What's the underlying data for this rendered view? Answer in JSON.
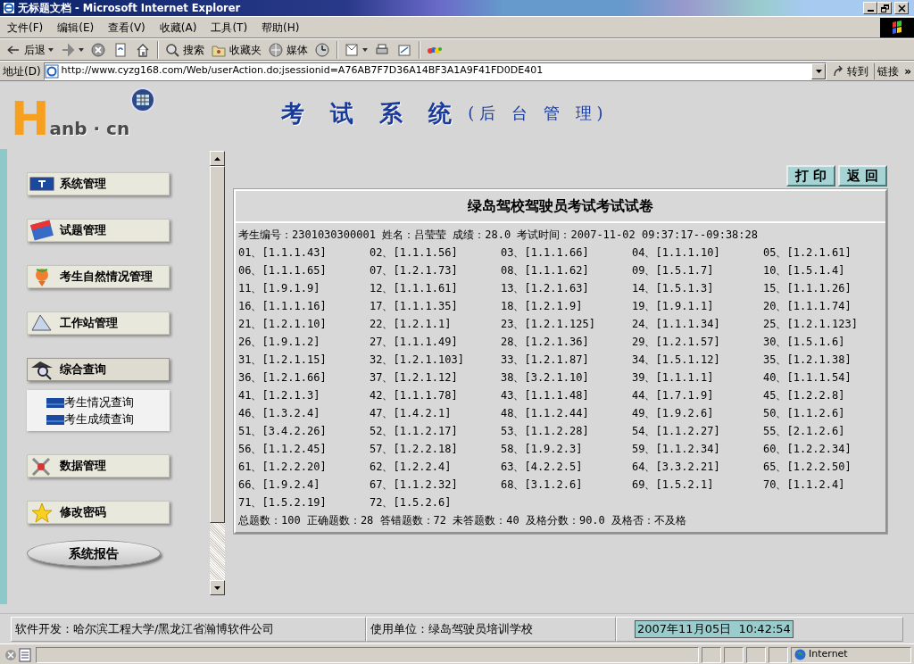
{
  "window": {
    "title": "无标题文档 - Microsoft Internet Explorer"
  },
  "menu": [
    "文件(F)",
    "编辑(E)",
    "查看(V)",
    "收藏(A)",
    "工具(T)",
    "帮助(H)"
  ],
  "toolbar": [
    [
      {
        "label": "后退",
        "dropdown": true
      },
      {
        "dropdown": true
      },
      {
        "dropdown": false
      },
      {
        "dropdown": false
      },
      {
        "dropdown": false
      }
    ],
    [
      {
        "label": "搜索",
        "dropdown": false
      },
      {
        "label": "收藏夹",
        "dropdown": false
      },
      {
        "label": "媒体",
        "dropdown": false
      },
      {
        "dropdown": false
      }
    ],
    [
      {
        "dropdown": true
      },
      {
        "dropdown": false
      },
      {
        "dropdown": false
      }
    ],
    [
      {
        "dropdown": false
      }
    ]
  ],
  "address": {
    "label": "地址(D)",
    "url": "http://www.cyzg168.com/Web/userAction.do;jsessionid=A76AB7F7D36A14BF3A1A9F41FD0DE401",
    "go": "转到",
    "links": "链接",
    "more": "»"
  },
  "header": {
    "logo_letter": "H",
    "logo_rest": "anb · cn",
    "title": "考 试 系 统",
    "subtitle": "(后 台 管 理)"
  },
  "sidebar": {
    "items": [
      {
        "label": "系统管理"
      },
      {
        "label": "试题管理"
      },
      {
        "label": "考生自然情况管理"
      },
      {
        "label": "工作站管理"
      },
      {
        "label": "综合查询",
        "expanded": true,
        "children": [
          {
            "label": "考生情况查询"
          },
          {
            "label": "考生成绩查询"
          }
        ]
      },
      {
        "label": "数据管理"
      },
      {
        "label": "修改密码"
      }
    ],
    "report_button": "系统报告"
  },
  "actions": [
    "打 印",
    "返 回"
  ],
  "paper": {
    "title": "绿岛驾校驾驶员考试考试试卷",
    "info": "考生编号：2301030300001 姓名：吕莹莹 成绩：28.0 考试时间：2007-11-02 09:37:17--09:38:28",
    "answers": [
      "01、[1.1.1.43]",
      "02、[1.1.1.56]",
      "03、[1.1.1.66]",
      "04、[1.1.1.10]",
      "05、[1.2.1.61]",
      "06、[1.1.1.65]",
      "07、[1.2.1.73]",
      "08、[1.1.1.62]",
      "09、[1.5.1.7]",
      "10、[1.5.1.4]",
      "11、[1.9.1.9]",
      "12、[1.1.1.61]",
      "13、[1.2.1.63]",
      "14、[1.5.1.3]",
      "15、[1.1.1.26]",
      "16、[1.1.1.16]",
      "17、[1.1.1.35]",
      "18、[1.2.1.9]",
      "19、[1.9.1.1]",
      "20、[1.1.1.74]",
      "21、[1.2.1.10]",
      "22、[1.2.1.1]",
      "23、[1.2.1.125]",
      "24、[1.1.1.34]",
      "25、[1.2.1.123]",
      "26、[1.9.1.2]",
      "27、[1.1.1.49]",
      "28、[1.2.1.36]",
      "29、[1.2.1.57]",
      "30、[1.5.1.6]",
      "31、[1.2.1.15]",
      "32、[1.2.1.103]",
      "33、[1.2.1.87]",
      "34、[1.5.1.12]",
      "35、[1.2.1.38]",
      "36、[1.2.1.66]",
      "37、[1.2.1.12]",
      "38、[3.2.1.10]",
      "39、[1.1.1.1]",
      "40、[1.1.1.54]",
      "41、[1.2.1.3]",
      "42、[1.1.1.78]",
      "43、[1.1.1.48]",
      "44、[1.7.1.9]",
      "45、[1.2.2.8]",
      "46、[1.3.2.4]",
      "47、[1.4.2.1]",
      "48、[1.1.2.44]",
      "49、[1.9.2.6]",
      "50、[1.1.2.6]",
      "51、[3.4.2.26]",
      "52、[1.1.2.17]",
      "53、[1.1.2.28]",
      "54、[1.1.2.27]",
      "55、[2.1.2.6]",
      "56、[1.1.2.45]",
      "57、[1.2.2.18]",
      "58、[1.9.2.3]",
      "59、[1.1.2.34]",
      "60、[1.2.2.34]",
      "61、[1.2.2.20]",
      "62、[1.2.2.4]",
      "63、[4.2.2.5]",
      "64、[3.3.2.21]",
      "65、[1.2.2.50]",
      "66、[1.9.2.4]",
      "67、[1.1.2.32]",
      "68、[3.1.2.6]",
      "69、[1.5.2.1]",
      "70、[1.1.2.4]",
      "71、[1.5.2.19]",
      "72、[1.5.2.6]"
    ],
    "summary": "总题数：100 正确题数：28 答错题数：72 未答题数：40 及格分数：90.0 及格否：不及格"
  },
  "footer": {
    "developer": "软件开发：哈尔滨工程大学/黑龙江省瀚博软件公司",
    "unit": "使用单位：绿岛驾驶员培训学校",
    "clock": "2007年11月05日  10:42:54"
  },
  "status_bar": {
    "zone": "Internet"
  }
}
